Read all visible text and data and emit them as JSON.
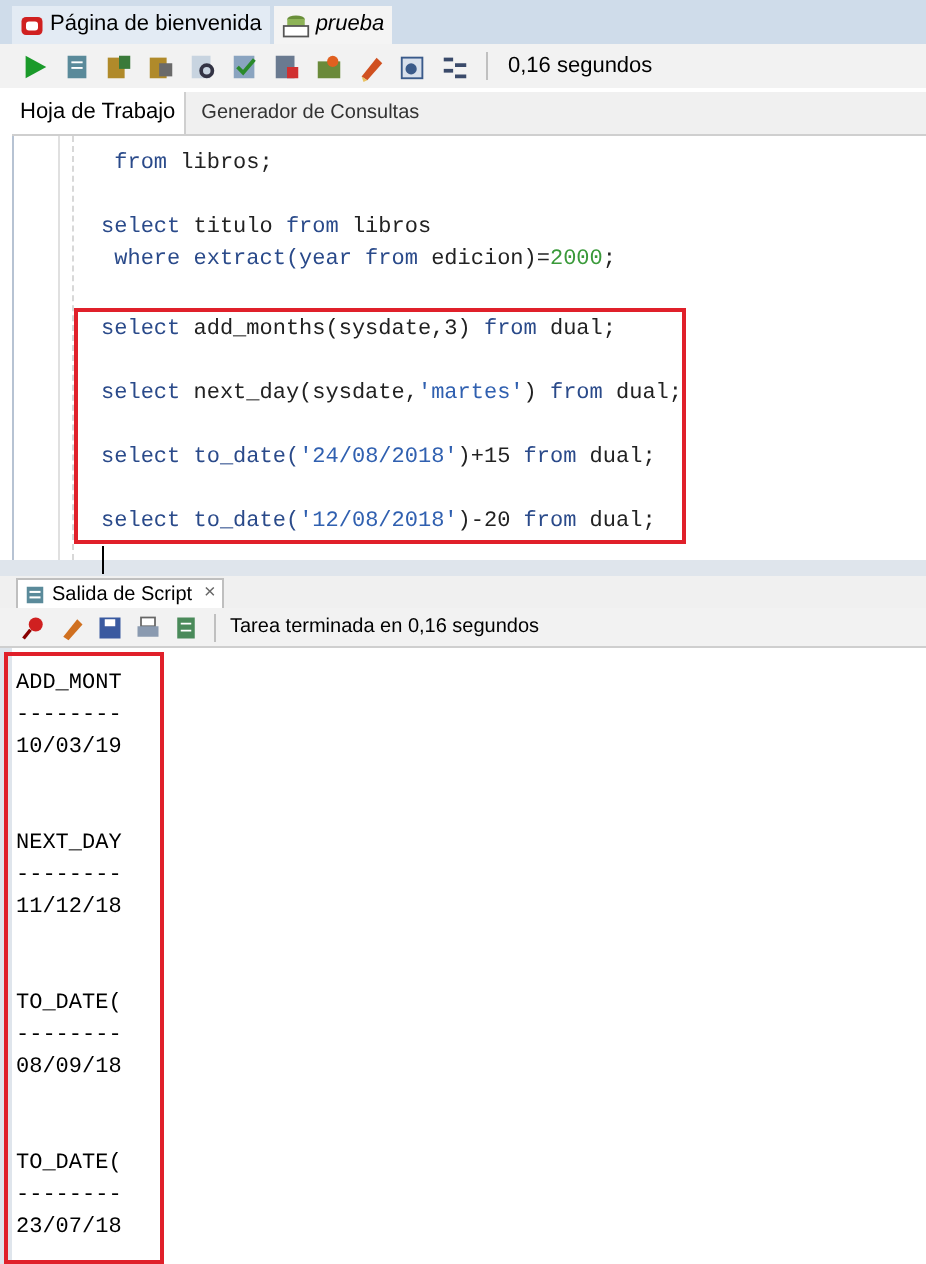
{
  "doc_tabs": [
    {
      "label": "Página de bienvenida",
      "selected": false
    },
    {
      "label": "prueba",
      "selected": true
    }
  ],
  "toolbar": {
    "time": "0,16 segundos"
  },
  "sub_tabs": [
    {
      "label": "Hoja de Trabajo",
      "selected": true
    },
    {
      "label": "Generador de Consultas",
      "selected": false
    }
  ],
  "editor": {
    "sections": [
      {
        "highlighted": false,
        "statements": [
          {
            "lines": [
              {
                "tokens": [
                  {
                    "text": " from",
                    "kind": "keyword"
                  },
                  {
                    "text": " libros;",
                    "kind": "plain"
                  }
                ]
              }
            ]
          },
          {
            "lines": [
              {
                "tokens": [
                  {
                    "text": "select",
                    "kind": "keyword"
                  },
                  {
                    "text": " titulo ",
                    "kind": "plain"
                  },
                  {
                    "text": "from",
                    "kind": "keyword"
                  },
                  {
                    "text": " libros",
                    "kind": "plain"
                  }
                ]
              },
              {
                "tokens": [
                  {
                    "text": " where extract(year from",
                    "kind": "keyword"
                  },
                  {
                    "text": " edicion)=",
                    "kind": "plain"
                  },
                  {
                    "text": "2000",
                    "kind": "number"
                  },
                  {
                    "text": ";",
                    "kind": "plain"
                  }
                ]
              }
            ]
          }
        ]
      },
      {
        "highlighted": true,
        "statements": [
          {
            "lines": [
              {
                "tokens": [
                  {
                    "text": "select",
                    "kind": "keyword"
                  },
                  {
                    "text": " add_months(sysdate,3) ",
                    "kind": "plain"
                  },
                  {
                    "text": "from",
                    "kind": "keyword"
                  },
                  {
                    "text": " dual;",
                    "kind": "plain"
                  }
                ]
              }
            ]
          },
          {
            "lines": [
              {
                "tokens": [
                  {
                    "text": "select",
                    "kind": "keyword"
                  },
                  {
                    "text": " next_day(sysdate,",
                    "kind": "plain"
                  },
                  {
                    "text": "'martes'",
                    "kind": "string"
                  },
                  {
                    "text": ") ",
                    "kind": "plain"
                  },
                  {
                    "text": "from",
                    "kind": "keyword"
                  },
                  {
                    "text": " dual;",
                    "kind": "plain"
                  }
                ]
              }
            ]
          },
          {
            "lines": [
              {
                "tokens": [
                  {
                    "text": "select to_date(",
                    "kind": "keyword"
                  },
                  {
                    "text": "'24/08/2018'",
                    "kind": "string"
                  },
                  {
                    "text": ")+15 ",
                    "kind": "plain"
                  },
                  {
                    "text": "from",
                    "kind": "keyword"
                  },
                  {
                    "text": " dual;",
                    "kind": "plain"
                  }
                ]
              }
            ]
          },
          {
            "lines": [
              {
                "tokens": [
                  {
                    "text": "select to_date(",
                    "kind": "keyword"
                  },
                  {
                    "text": "'12/08/2018'",
                    "kind": "string"
                  },
                  {
                    "text": ")-20 ",
                    "kind": "plain"
                  },
                  {
                    "text": "from",
                    "kind": "keyword"
                  },
                  {
                    "text": " dual;",
                    "kind": "plain"
                  }
                ]
              }
            ]
          }
        ]
      }
    ]
  },
  "output_panel": {
    "tab": "Salida de Script",
    "close": "×",
    "status": "Tarea terminada en 0,16 segundos",
    "results": [
      {
        "header": "ADD_MONT",
        "rule": "--------",
        "value": "10/03/19"
      },
      {
        "header": "NEXT_DAY",
        "rule": "--------",
        "value": "11/12/18"
      },
      {
        "header": "TO_DATE(",
        "rule": "--------",
        "value": "08/09/18"
      },
      {
        "header": "TO_DATE(",
        "rule": "--------",
        "value": "23/07/18"
      }
    ]
  }
}
